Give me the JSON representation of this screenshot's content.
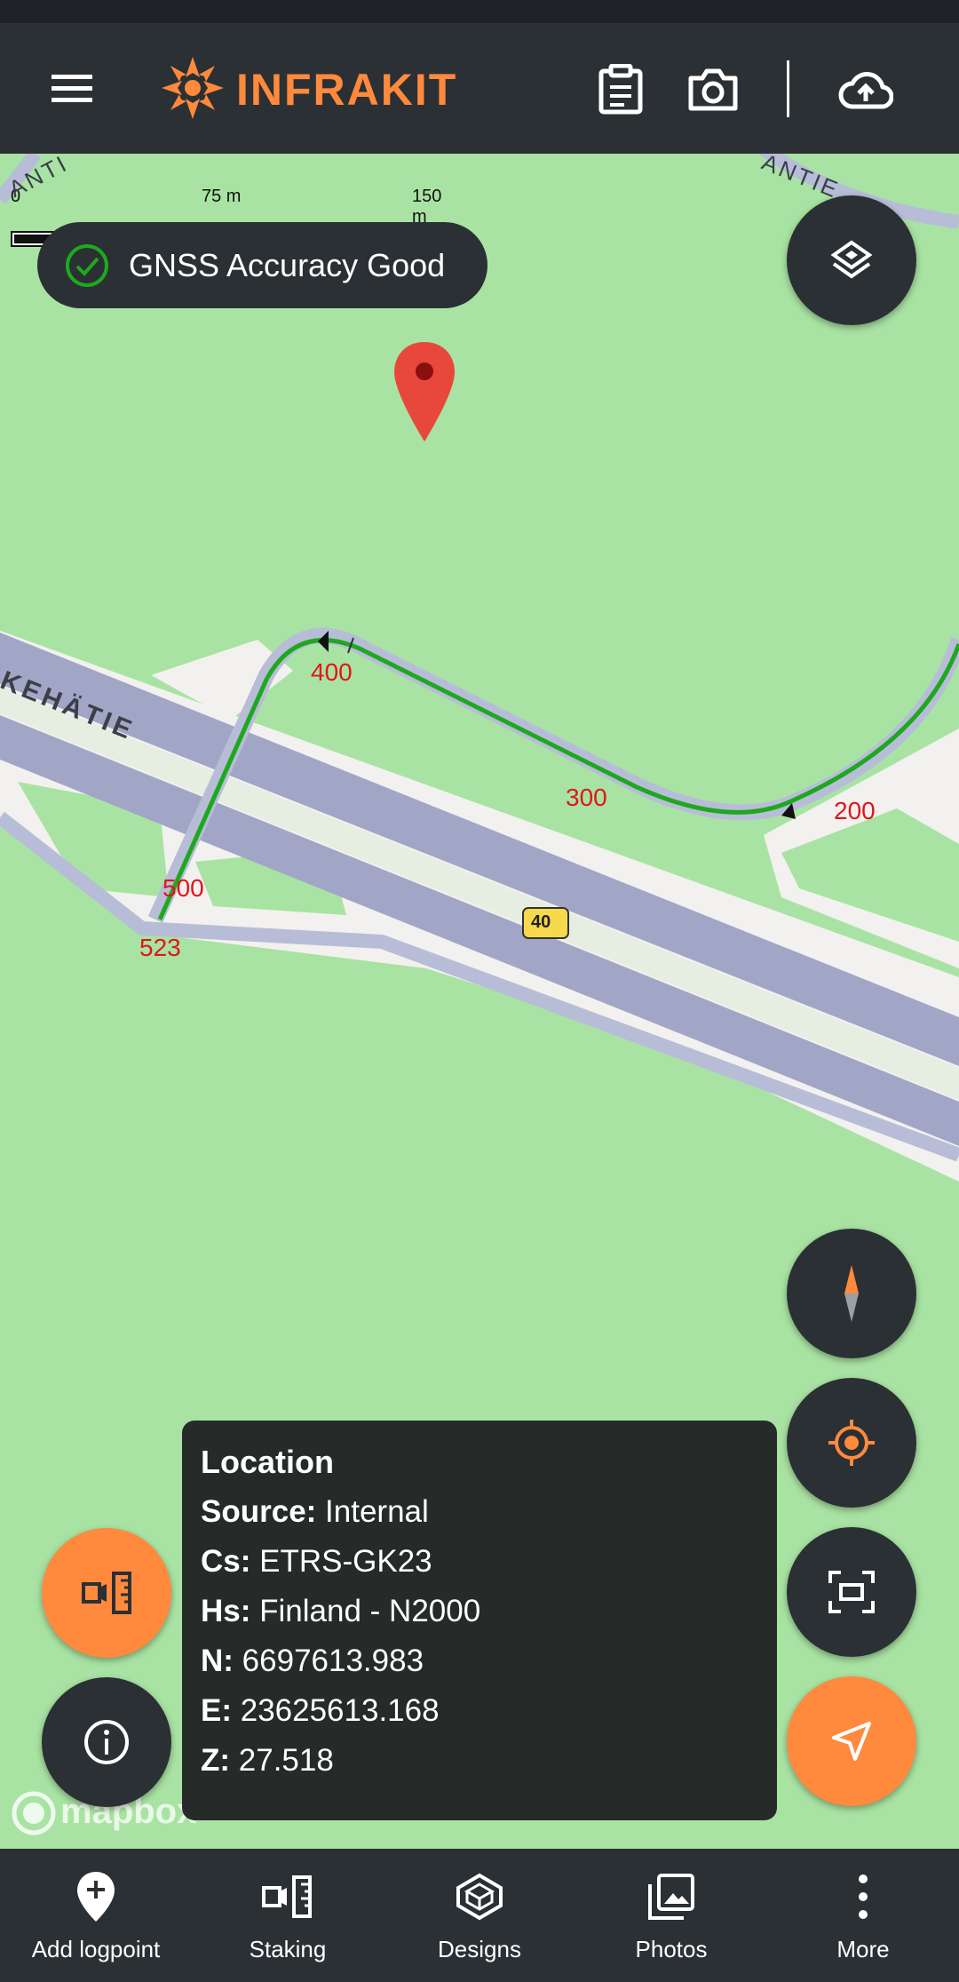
{
  "app": {
    "brand": "INFRAKIT"
  },
  "gnss": {
    "text": "GNSS Accuracy Good"
  },
  "scale": {
    "zero": "0",
    "mid": "75 m",
    "max": "150 m"
  },
  "map": {
    "road_labels": {
      "top_right": "ANTIE",
      "left": "KEHÄTIE",
      "top_left": "ANTI"
    },
    "station_labels": [
      "400",
      "300",
      "200",
      "500",
      "523"
    ],
    "road_shield": "40",
    "attribution": "mapbox"
  },
  "location": {
    "title": "Location",
    "source_label": "Source:",
    "source_value": "Internal",
    "cs_label": "Cs:",
    "cs_value": "ETRS-GK23",
    "hs_label": "Hs:",
    "hs_value": "Finland - N2000",
    "n_label": "N:",
    "n_value": "6697613.983",
    "e_label": "E:",
    "e_value": "23625613.168",
    "z_label": "Z:",
    "z_value": "27.518"
  },
  "nav": [
    {
      "label": "Add logpoint"
    },
    {
      "label": "Staking"
    },
    {
      "label": "Designs"
    },
    {
      "label": "Photos"
    },
    {
      "label": "More"
    }
  ],
  "colors": {
    "accent": "#ff8a3d",
    "panel": "#2b3034",
    "map_green": "#a9e3a3",
    "alignment": "#1fa81f",
    "label_red": "#e0161a"
  }
}
